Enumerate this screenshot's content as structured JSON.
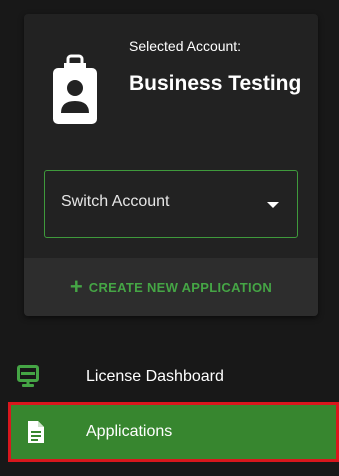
{
  "account": {
    "caption": "Selected Account:",
    "name": "Business Testing",
    "switch_label": "Switch Account",
    "create_label": "CREATE NEW APPLICATION"
  },
  "nav": {
    "items": [
      {
        "label": "License Dashboard",
        "icon": "monitor-icon"
      },
      {
        "label": "Applications",
        "icon": "document-icon",
        "selected": true
      }
    ]
  },
  "colors": {
    "accent_green": "#45a545",
    "selected_bg": "#37862f",
    "highlight_border": "#d9171d",
    "card_bg": "#222222",
    "page_bg": "#181818"
  }
}
